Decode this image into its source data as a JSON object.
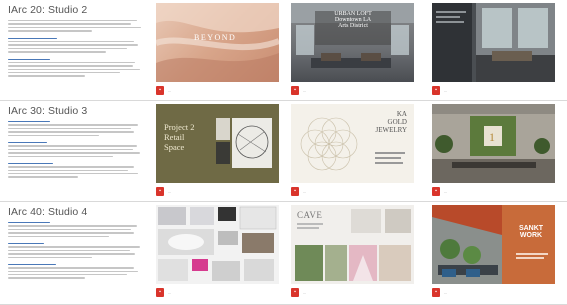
{
  "rows": [
    {
      "title": "IArc 20: Studio 2",
      "cards": [
        {
          "thumb_title": "BEYOND",
          "thumb_sub": "",
          "filename": "...",
          "size": ""
        },
        {
          "thumb_title": "URBAN LOFT",
          "thumb_sub": "Downtown LA",
          "thumb_sub2": "Arts District",
          "filename": "...",
          "size": ""
        },
        {
          "thumb_title": "",
          "thumb_sub": "",
          "filename": "...",
          "size": ""
        }
      ]
    },
    {
      "title": "IArc 30: Studio 3",
      "cards": [
        {
          "thumb_title": "Project 2",
          "thumb_sub": "Retail",
          "thumb_sub2": "Space",
          "filename": "...",
          "size": ""
        },
        {
          "thumb_title": "KA",
          "thumb_sub": "GOLD",
          "thumb_sub2": "JEWELRY",
          "filename": "...",
          "size": ""
        },
        {
          "thumb_title": "",
          "thumb_sub": "",
          "filename": "...",
          "size": ""
        }
      ]
    },
    {
      "title": "IArc 40: Studio 4",
      "cards": [
        {
          "thumb_title": "",
          "thumb_sub": "",
          "filename": "...",
          "size": ""
        },
        {
          "thumb_title": "CAVE",
          "thumb_sub": "",
          "filename": "...",
          "size": ""
        },
        {
          "thumb_title": "SANKT WORK",
          "thumb_sub": "",
          "filename": "...",
          "size": ""
        }
      ]
    }
  ],
  "icons": {
    "file_type": "pdf-icon"
  },
  "colors": {
    "pdf_red": "#d9342b",
    "link_blue": "#4a78b8",
    "olive": "#6f6a45",
    "terracotta": "#c86b3a"
  }
}
